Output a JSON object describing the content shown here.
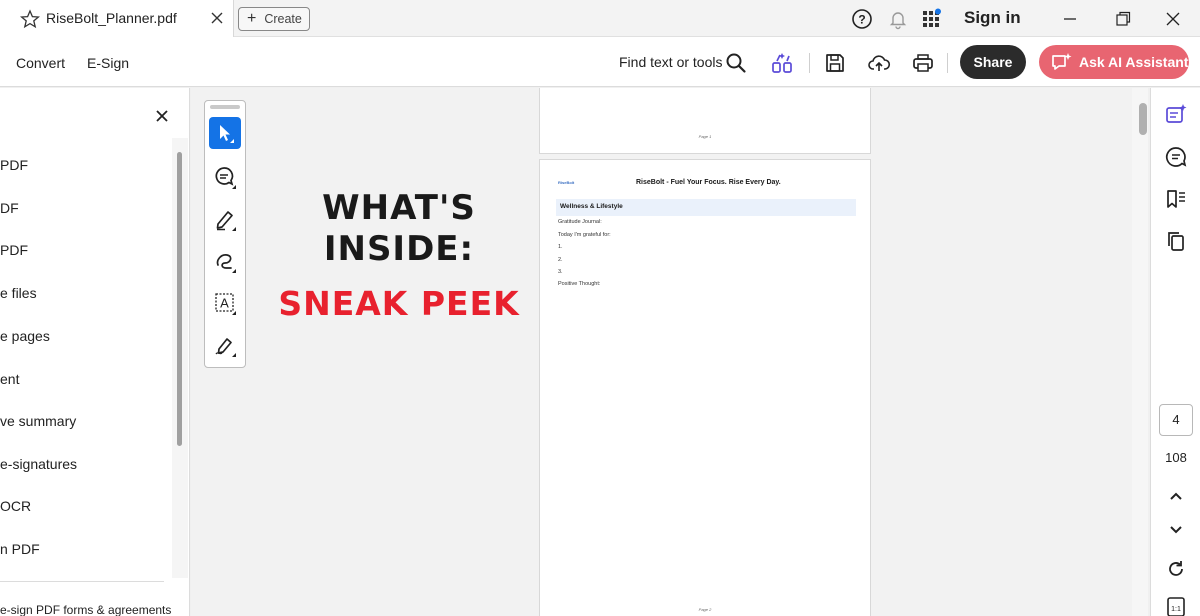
{
  "tab": {
    "title": "RiseBolt_Planner.pdf",
    "create_label": "Create"
  },
  "header": {
    "sign_in": "Sign in"
  },
  "toolbar": {
    "menu": [
      "Convert",
      "E-Sign"
    ],
    "find_label": "Find text or tools",
    "share_label": "Share",
    "ai_label": "Ask AI Assistant",
    "ai_color": "#e86571"
  },
  "left_panel": {
    "items": [
      "PDF",
      "DF",
      "PDF",
      "e files",
      "e pages",
      "ent",
      "ve summary",
      "e-signatures",
      "OCR",
      "n PDF"
    ],
    "bottom_text": "e-sign PDF forms & agreements"
  },
  "canvas": {
    "headline_line1": "WHAT'S",
    "headline_line2": "INSIDE:",
    "headline_accent": "SNEAK PEEK",
    "accent_color": "#e8212e"
  },
  "document": {
    "page1_label": "Page 1",
    "page2": {
      "logo": "RiseBolt",
      "header": "RiseBolt - Fuel Your Focus. Rise Every Day.",
      "section": "Wellness & Lifestyle",
      "lines": [
        "Gratitude Journal:",
        "Today I'm grateful for:",
        "1.",
        "2.",
        "3.",
        "Positive Thought:"
      ],
      "footer_label": "Page 2"
    }
  },
  "page_nav": {
    "current": "4",
    "total": "108"
  }
}
